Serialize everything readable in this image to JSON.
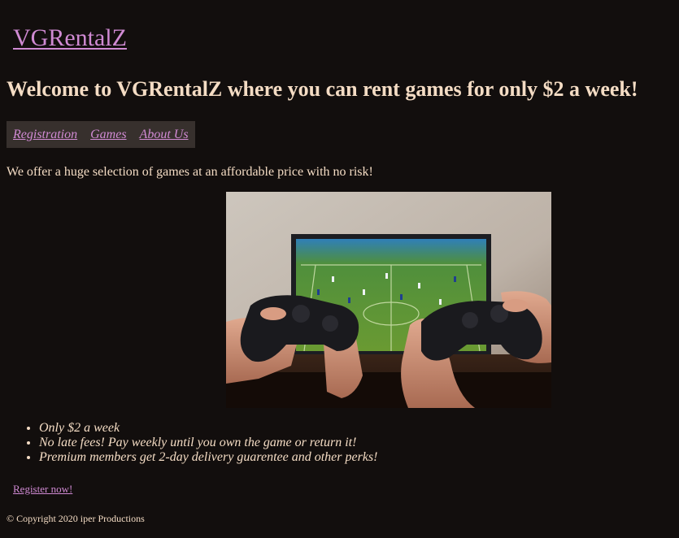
{
  "site": {
    "logo": "VGRentalZ",
    "headline": "Welcome to VGRentalZ where you can rent games for only $2 a week!"
  },
  "nav": {
    "items": [
      {
        "label": "Registration"
      },
      {
        "label": "Games"
      },
      {
        "label": "About Us"
      }
    ]
  },
  "main": {
    "intro": "We offer a huge selection of games at an affordable price with no risk!",
    "perks": [
      "Only $2 a week",
      "No late fees! Pay weekly until you own the game or return it!",
      "Premium members get 2-day delivery guarentee and other perks!"
    ],
    "cta": "Register now!"
  },
  "footer": {
    "copyright": "© Copyright 2020 iper Productions"
  },
  "colors": {
    "background": "#120e0d",
    "text": "#f4dcc4",
    "link": "#d08ad3",
    "nav_background": "#37302d"
  }
}
